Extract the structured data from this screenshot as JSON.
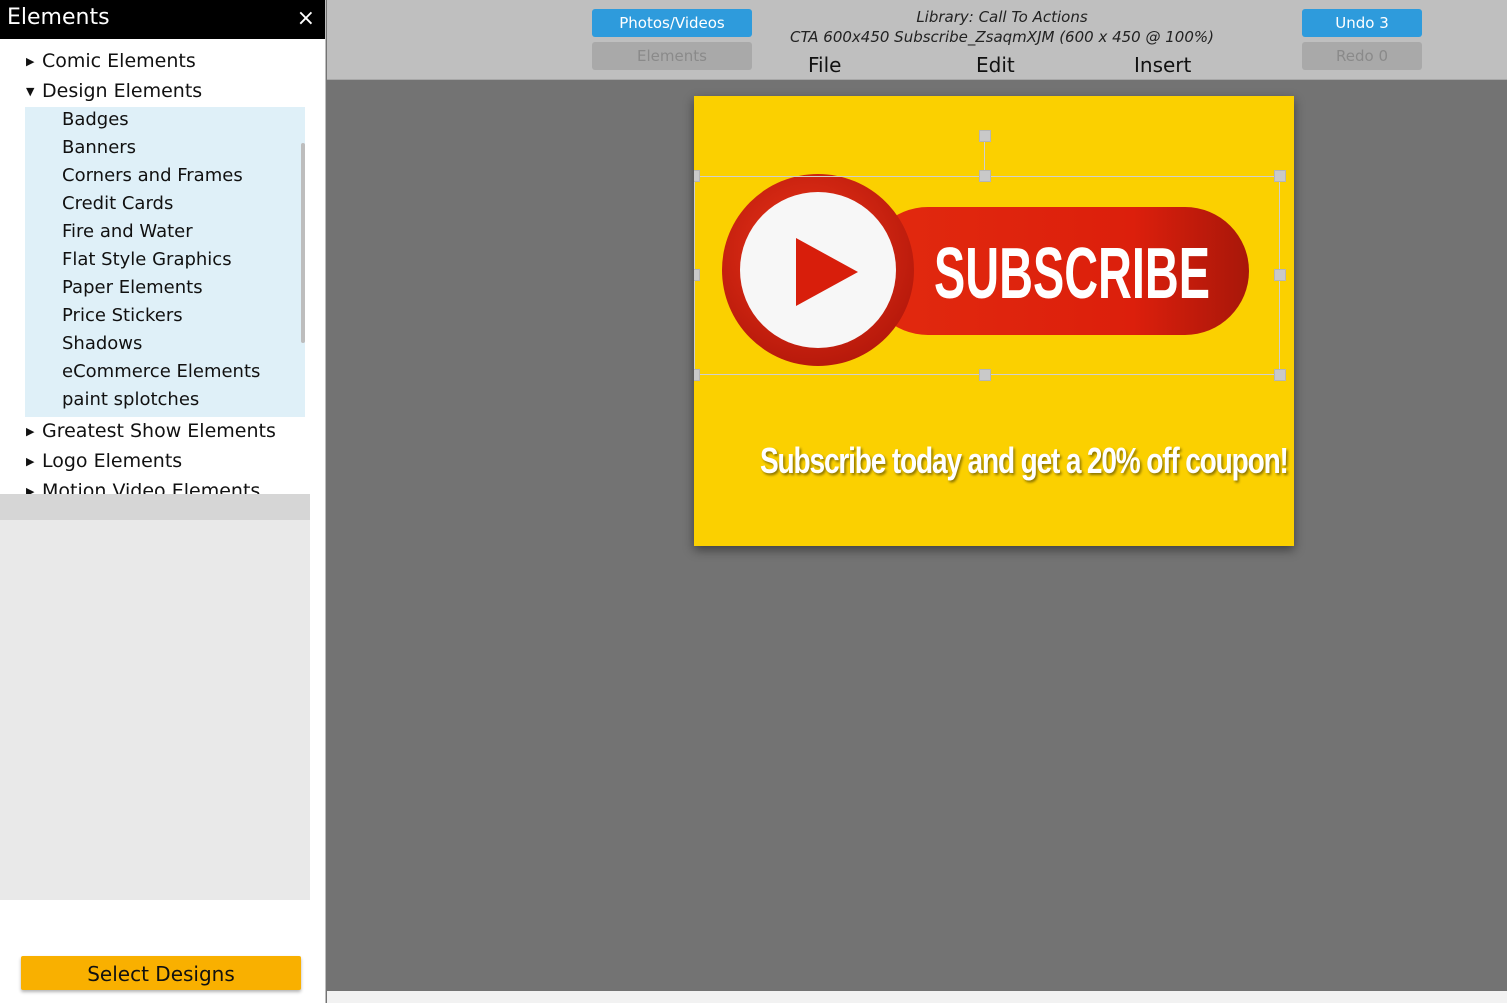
{
  "panel": {
    "title": "Elements",
    "close_icon": "×",
    "categories": [
      {
        "label": "Comic Elements",
        "expanded": false
      },
      {
        "label": "Design Elements",
        "expanded": true
      },
      {
        "label": "Greatest Show Elements",
        "expanded": false
      },
      {
        "label": "Logo Elements",
        "expanded": false
      },
      {
        "label": "Motion Video Elements",
        "expanded": false
      }
    ],
    "subcategories": [
      "Badges",
      "Banners",
      "Corners and Frames",
      "Credit Cards",
      "Fire and Water",
      "Flat Style Graphics",
      "Paper Elements",
      "Price Stickers",
      "Shadows",
      "eCommerce Elements",
      "paint splotches"
    ],
    "select_button": "Select Designs"
  },
  "topbar": {
    "photos_videos": "Photos/Videos",
    "elements": "Elements",
    "library_line": "Library: Call To Actions",
    "doc_line": "CTA 600x450 Subscribe_ZsaqmXJM (600 x 450 @ 100%)",
    "menus": [
      "File",
      "Edit",
      "Insert"
    ],
    "undo": "Undo 3",
    "redo": "Redo 0"
  },
  "design": {
    "background_color": "#fbd000",
    "subscribe_label": "SUBSCRIBE",
    "coupon_text": "Subscribe today and get a 20% off coupon!"
  },
  "colors": {
    "accent_blue": "#2e9bdc",
    "select_button": "#f9b000",
    "subscribe_red": "#e01f0f"
  }
}
